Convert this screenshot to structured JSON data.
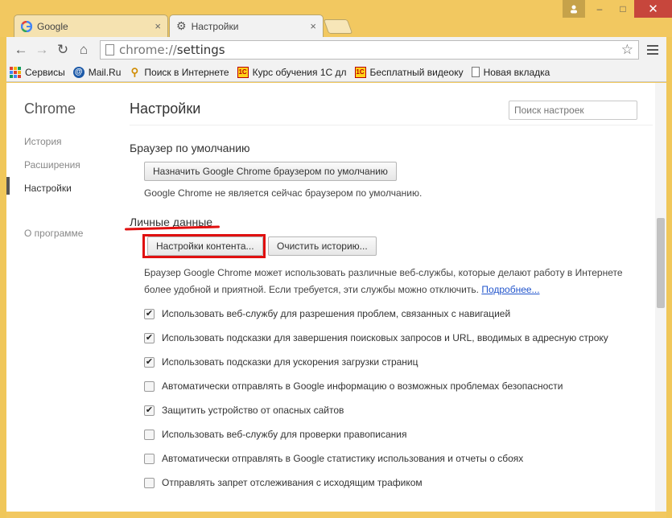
{
  "window": {
    "user_icon": "person-icon",
    "minimize": "–",
    "maximize": "□",
    "close": "✕"
  },
  "tabs": [
    {
      "title": "Google",
      "icon": "google-favicon",
      "close": "×",
      "active": false
    },
    {
      "title": "Настройки",
      "icon": "gear-icon",
      "close": "×",
      "active": true
    }
  ],
  "toolbar": {
    "back": "←",
    "forward": "→",
    "reload": "↻",
    "home": "⌂",
    "url_scheme": "chrome://",
    "url_path": "settings",
    "star": "☆"
  },
  "bookmarks": [
    {
      "label": "Сервисы",
      "icon": "apps-icon"
    },
    {
      "label": "Mail.Ru",
      "icon": "mailru-icon"
    },
    {
      "label": "Поиск в Интернете",
      "icon": "search-icon"
    },
    {
      "label": "Курс обучения 1С дл",
      "icon": "1c-icon"
    },
    {
      "label": "Бесплатный видеоку",
      "icon": "1c-icon"
    },
    {
      "label": "Новая вкладка",
      "icon": "page-icon"
    }
  ],
  "sidebar": {
    "brand": "Chrome",
    "items": [
      {
        "label": "История",
        "active": false
      },
      {
        "label": "Расширения",
        "active": false
      },
      {
        "label": "Настройки",
        "active": true
      },
      {
        "label": "О программе",
        "active": false
      }
    ]
  },
  "main": {
    "title": "Настройки",
    "search_placeholder": "Поиск настроек",
    "default_browser": {
      "heading": "Браузер по умолчанию",
      "button": "Назначить Google Chrome браузером по умолчанию",
      "note": "Google Chrome не является сейчас браузером по умолчанию."
    },
    "privacy": {
      "heading": "Личные данные",
      "content_settings_button": "Настройки контента...",
      "clear_history_button": "Очистить историю...",
      "description": "Браузер Google Chrome может использовать различные веб-службы, которые делают работу в Интернете более удобной и приятной. Если требуется, эти службы можно отключить.",
      "learn_more": "Подробнее..."
    },
    "checkboxes": [
      {
        "label": "Использовать веб-службу для разрешения проблем, связанных с навигацией",
        "checked": true
      },
      {
        "label": "Использовать подсказки для завершения поисковых запросов и URL, вводимых в адресную строку",
        "checked": true
      },
      {
        "label": "Использовать подсказки для ускорения загрузки страниц",
        "checked": true
      },
      {
        "label": "Автоматически отправлять в Google информацию о возможных проблемах безопасности",
        "checked": false
      },
      {
        "label": "Защитить устройство от опасных сайтов",
        "checked": true
      },
      {
        "label": "Использовать веб-службу для проверки правописания",
        "checked": false
      },
      {
        "label": "Автоматически отправлять в Google статистику использования и отчеты о сбоях",
        "checked": false
      },
      {
        "label": "Отправлять запрет отслеживания с исходящим трафиком",
        "checked": false
      }
    ],
    "checkmark": "✔"
  },
  "colors": {
    "frame": "#f2c860",
    "annotation_red": "#e01010",
    "link": "#2255cc"
  }
}
